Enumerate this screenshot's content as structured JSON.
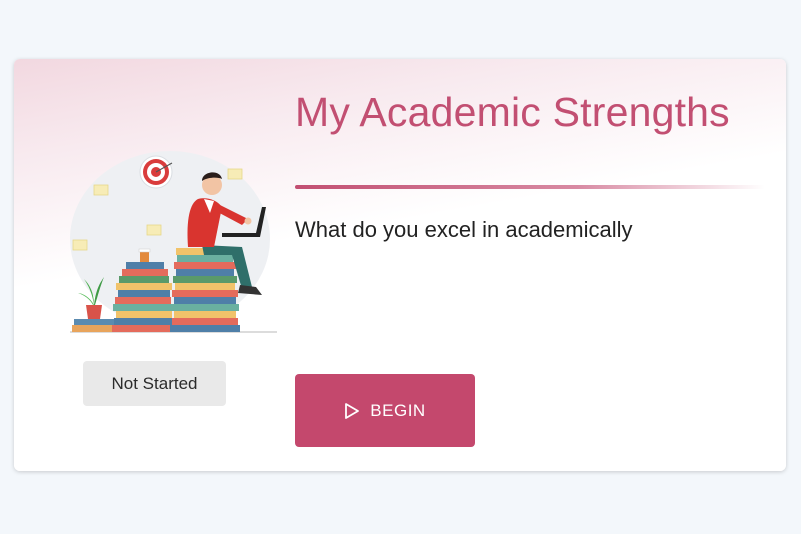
{
  "card": {
    "title": "My Academic Strengths",
    "subtitle": "What do you excel in academically",
    "status": "Not Started",
    "begin_label": "BEGIN",
    "illustration_icon": "student-on-books-illustration",
    "begin_icon": "play-icon"
  },
  "colors": {
    "accent": "#c4486d",
    "title": "#c24f72",
    "status_bg": "#e9e9e9",
    "page_bg": "#f3f7fb"
  }
}
